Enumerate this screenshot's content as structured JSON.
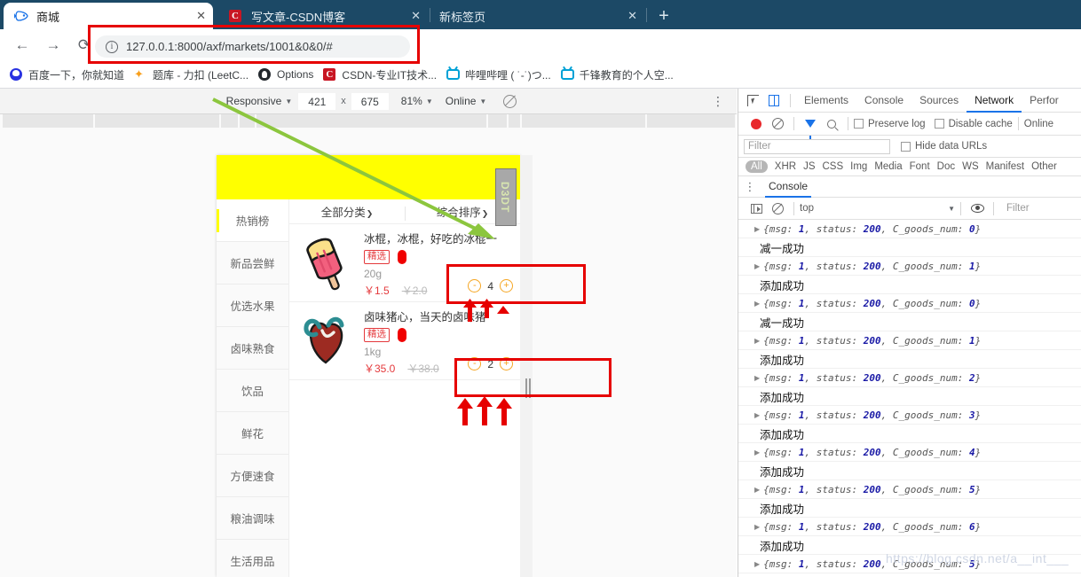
{
  "browser": {
    "tabs": [
      {
        "title": "商城",
        "favicon": "fish-icon",
        "active": true,
        "close_label": "✕"
      },
      {
        "title": "写文章-CSDN博客",
        "favicon": "csdn-icon",
        "active": false,
        "close_label": "✕"
      },
      {
        "title": "新标签页",
        "favicon": "none",
        "active": false,
        "close_label": "✕"
      }
    ],
    "new_tab_label": "+",
    "nav": {
      "back": "←",
      "forward": "→",
      "reload": "⟳"
    },
    "omnibox": {
      "info_icon": "ⓘ",
      "url": "127.0.0.1:8000/axf/markets/1001&0&0/#"
    },
    "bookmarks": [
      {
        "label": "百度一下，你就知道",
        "icon": "baidu-icon"
      },
      {
        "label": "题库 - 力扣 (LeetC...",
        "icon": "leetcode-icon"
      },
      {
        "label": "Options",
        "icon": "github-icon"
      },
      {
        "label": "CSDN-专业IT技术...",
        "icon": "csdn-icon"
      },
      {
        "label": "哔哩哔哩 ( ˙-˙)つ...",
        "icon": "bilibili-icon"
      },
      {
        "label": "千锋教育的个人空...",
        "icon": "bilibili-icon"
      }
    ]
  },
  "device_toolbar": {
    "device": "Responsive",
    "width": "421",
    "separator": "x",
    "height": "675",
    "zoom": "81%",
    "throttling": "Online",
    "caret": "▼",
    "kebab": "⋮"
  },
  "mobile_page": {
    "banner_color": "#ffff00",
    "sidebar": [
      {
        "label": "热销榜",
        "active": true
      },
      {
        "label": "新品尝鲜",
        "active": false
      },
      {
        "label": "优选水果",
        "active": false
      },
      {
        "label": "卤味熟食",
        "active": false
      },
      {
        "label": "饮品",
        "active": false
      },
      {
        "label": "鲜花",
        "active": false
      },
      {
        "label": "方便速食",
        "active": false
      },
      {
        "label": "粮油调味",
        "active": false
      },
      {
        "label": "生活用品",
        "active": false
      }
    ],
    "sortbar": [
      {
        "label": "全部分类",
        "caret": "❯"
      },
      {
        "label": "综合排序",
        "caret": "❯"
      }
    ],
    "products": [
      {
        "title": "冰棍，冰棍，好吃的冰棍一",
        "tag": "精选",
        "spec": "20g",
        "price": "￥1.5",
        "old_price": "￥2.0",
        "minus": "-",
        "quantity": "4",
        "plus": "+",
        "image": "popsicle-icon"
      },
      {
        "title": "卤味猪心，当天的卤味猪",
        "tag": "精选",
        "spec": "1kg",
        "price": "￥35.0",
        "old_price": "￥38.0",
        "minus": "-",
        "quantity": "2",
        "plus": "+",
        "image": "heart-icon"
      }
    ],
    "overlay_badge": "D3DT"
  },
  "devtools": {
    "panel_tabs": [
      "Elements",
      "Console",
      "Sources",
      "Network",
      "Perfor"
    ],
    "selected_panel": "Network",
    "network_bar": {
      "preserve_log": "Preserve log",
      "disable_cache": "Disable cache",
      "throttle": "Online"
    },
    "filter_placeholder": "Filter",
    "hide_data_urls": "Hide data URLs",
    "resource_types": [
      "All",
      "XHR",
      "JS",
      "CSS",
      "Img",
      "Media",
      "Font",
      "Doc",
      "WS",
      "Manifest",
      "Other"
    ],
    "drawer_tab": "Console",
    "console_bar": {
      "context": "top",
      "caret": "▼",
      "filter_placeholder": "Filter"
    },
    "console_logs": [
      {
        "type": "object",
        "text": "{msg: 1, status: 200, C_goods_num: 0}"
      },
      {
        "type": "text",
        "text": "减一成功"
      },
      {
        "type": "object",
        "text": "{msg: 1, status: 200, C_goods_num: 1}"
      },
      {
        "type": "text",
        "text": "添加成功"
      },
      {
        "type": "object",
        "text": "{msg: 1, status: 200, C_goods_num: 0}"
      },
      {
        "type": "text",
        "text": "减一成功"
      },
      {
        "type": "object",
        "text": "{msg: 1, status: 200, C_goods_num: 1}"
      },
      {
        "type": "text",
        "text": "添加成功"
      },
      {
        "type": "object",
        "text": "{msg: 1, status: 200, C_goods_num: 2}"
      },
      {
        "type": "text",
        "text": "添加成功"
      },
      {
        "type": "object",
        "text": "{msg: 1, status: 200, C_goods_num: 3}"
      },
      {
        "type": "text",
        "text": "添加成功"
      },
      {
        "type": "object",
        "text": "{msg: 1, status: 200, C_goods_num: 4}"
      },
      {
        "type": "text",
        "text": "添加成功"
      },
      {
        "type": "object",
        "text": "{msg: 1, status: 200, C_goods_num: 5}"
      },
      {
        "type": "text",
        "text": "添加成功"
      },
      {
        "type": "object",
        "text": "{msg: 1, status: 200, C_goods_num: 6}"
      },
      {
        "type": "text",
        "text": "添加成功"
      },
      {
        "type": "object",
        "text": "{msg: 1, status: 200, C_goods_num: 5}"
      }
    ]
  },
  "annotations": {
    "highlight_color": "#e60000",
    "arrow_color": "#8cc63e",
    "watermark": "https://blog.csdn.net/a__int___"
  }
}
